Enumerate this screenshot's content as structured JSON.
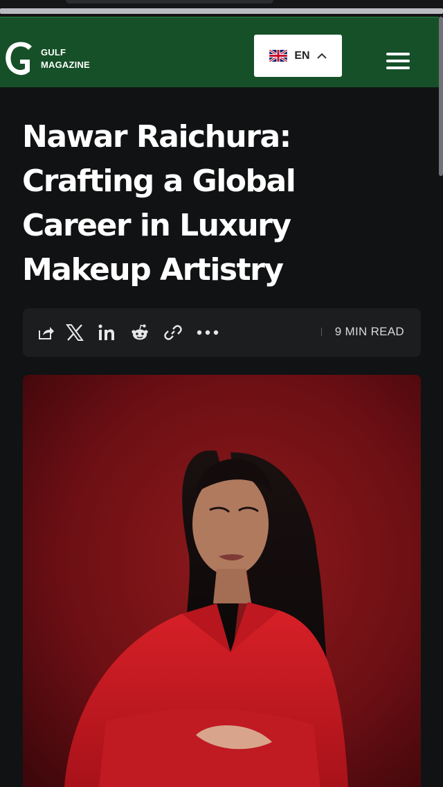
{
  "site": {
    "logo_line1": "GULF",
    "logo_line2": "MAGAZINE",
    "brand_color": "#165028"
  },
  "language": {
    "code": "EN",
    "flag": "uk-flag-icon"
  },
  "article": {
    "title_lines": [
      "Nawar Raichura:",
      "Crafting a Global",
      "Career in Luxury",
      "Makeup Artistry"
    ],
    "read_time": "9 MIN READ"
  },
  "share": {
    "icons": [
      "share-icon",
      "x-icon",
      "linkedin-icon",
      "reddit-icon",
      "link-icon",
      "more-icon"
    ]
  },
  "hero": {
    "background": "#7a1014",
    "subject_top_color": "#d01c22"
  }
}
